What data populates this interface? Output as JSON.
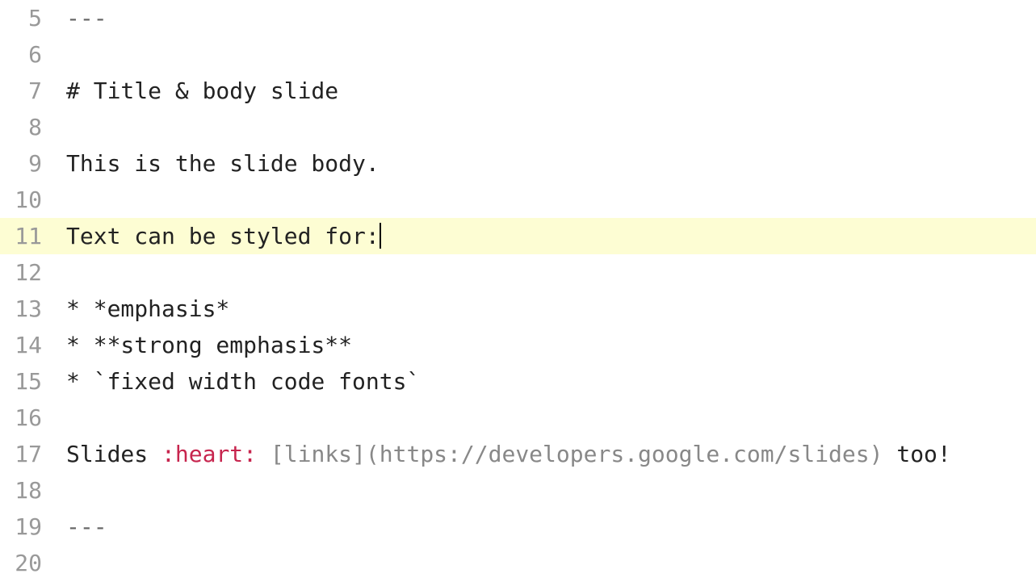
{
  "editor": {
    "currentLine": 11,
    "lines": [
      {
        "num": 5,
        "segments": [
          {
            "cls": "tok-dashes",
            "text": "---"
          }
        ]
      },
      {
        "num": 6,
        "segments": []
      },
      {
        "num": 7,
        "segments": [
          {
            "cls": "",
            "text": "# Title & body slide"
          }
        ]
      },
      {
        "num": 8,
        "segments": []
      },
      {
        "num": 9,
        "segments": [
          {
            "cls": "",
            "text": "This is the slide body."
          }
        ]
      },
      {
        "num": 10,
        "segments": []
      },
      {
        "num": 11,
        "segments": [
          {
            "cls": "",
            "text": "Text can be styled for:"
          }
        ],
        "caret": true
      },
      {
        "num": 12,
        "segments": []
      },
      {
        "num": 13,
        "segments": [
          {
            "cls": "",
            "text": "* *emphasis*"
          }
        ]
      },
      {
        "num": 14,
        "segments": [
          {
            "cls": "",
            "text": "* **strong emphasis**"
          }
        ]
      },
      {
        "num": 15,
        "segments": [
          {
            "cls": "",
            "text": "* `fixed width code fonts`"
          }
        ]
      },
      {
        "num": 16,
        "segments": []
      },
      {
        "num": 17,
        "segments": [
          {
            "cls": "",
            "text": "Slides "
          },
          {
            "cls": "tok-emoji",
            "text": ":heart:"
          },
          {
            "cls": "",
            "text": " "
          },
          {
            "cls": "tok-link",
            "text": "[links](https://developers.google.com/slides)"
          },
          {
            "cls": "",
            "text": " too!"
          }
        ]
      },
      {
        "num": 18,
        "segments": []
      },
      {
        "num": 19,
        "segments": [
          {
            "cls": "tok-dashes",
            "text": "---"
          }
        ]
      },
      {
        "num": 20,
        "segments": []
      }
    ]
  }
}
